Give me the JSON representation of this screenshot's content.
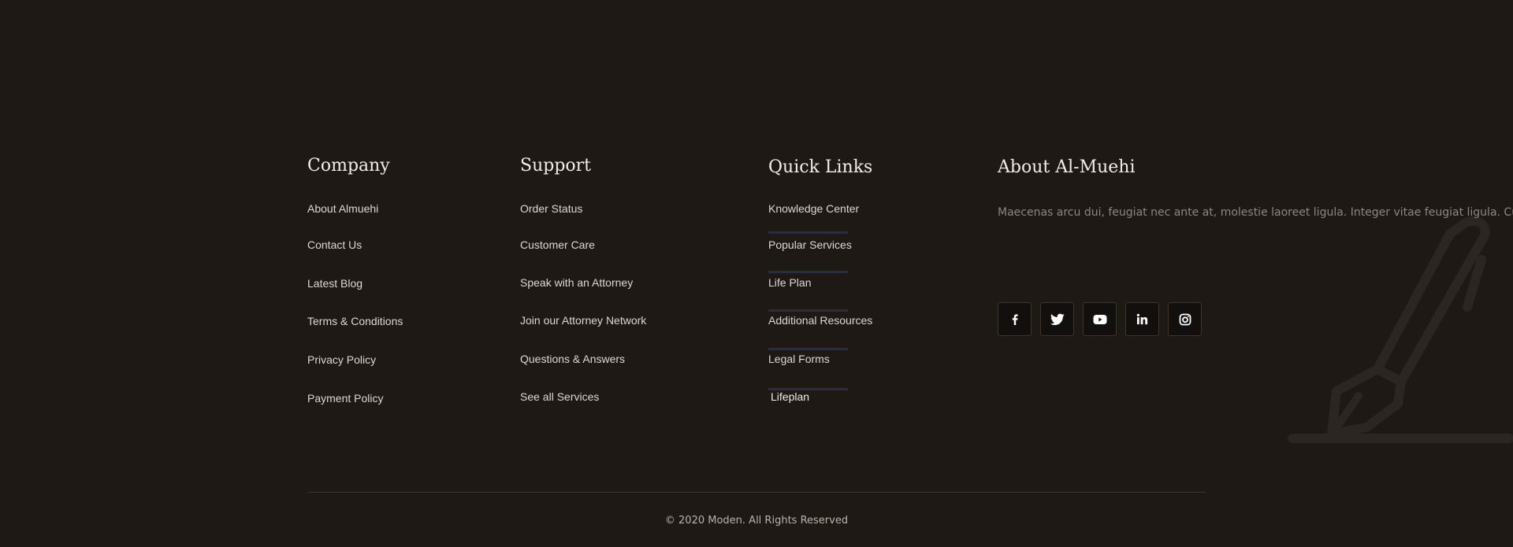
{
  "company": {
    "title": "Company",
    "links": [
      "About Almuehi",
      "Contact Us",
      "Latest Blog",
      "Terms & Conditions",
      "Privacy Policy",
      "Payment Policy"
    ]
  },
  "support": {
    "title": "Support",
    "links": [
      "Order Status",
      "Customer Care",
      "Speak with an Attorney",
      "Join our Attorney Network",
      "Questions & Answers",
      "See all Services"
    ]
  },
  "quick_links": {
    "title": "Quick Links",
    "links": [
      "Knowledge Center",
      "Popular Services",
      "Life Plan",
      "Additional Resources",
      "Legal Forms",
      "Lifeplan"
    ],
    "separator_color": "#2c2c40"
  },
  "about": {
    "title": "About Al-Muehi",
    "text": "Maecenas arcu dui, feugiat nec ante at, molestie laoreet ligula. Integer vitae feugiat ligula. Curabitur v",
    "social": [
      {
        "icon": "facebook-icon"
      },
      {
        "icon": "twitter-icon"
      },
      {
        "icon": "youtube-icon"
      },
      {
        "icon": "linkedin-icon"
      },
      {
        "icon": "instagram-icon"
      }
    ]
  },
  "footer": {
    "copyright": "© 2020 Moden. All Rights Reserved"
  },
  "colors": {
    "background": "#1e1915",
    "heading": "#f1ede7",
    "link": "#ddd8d1",
    "muted": "#8e8780",
    "social_bg": "#120f0d"
  }
}
